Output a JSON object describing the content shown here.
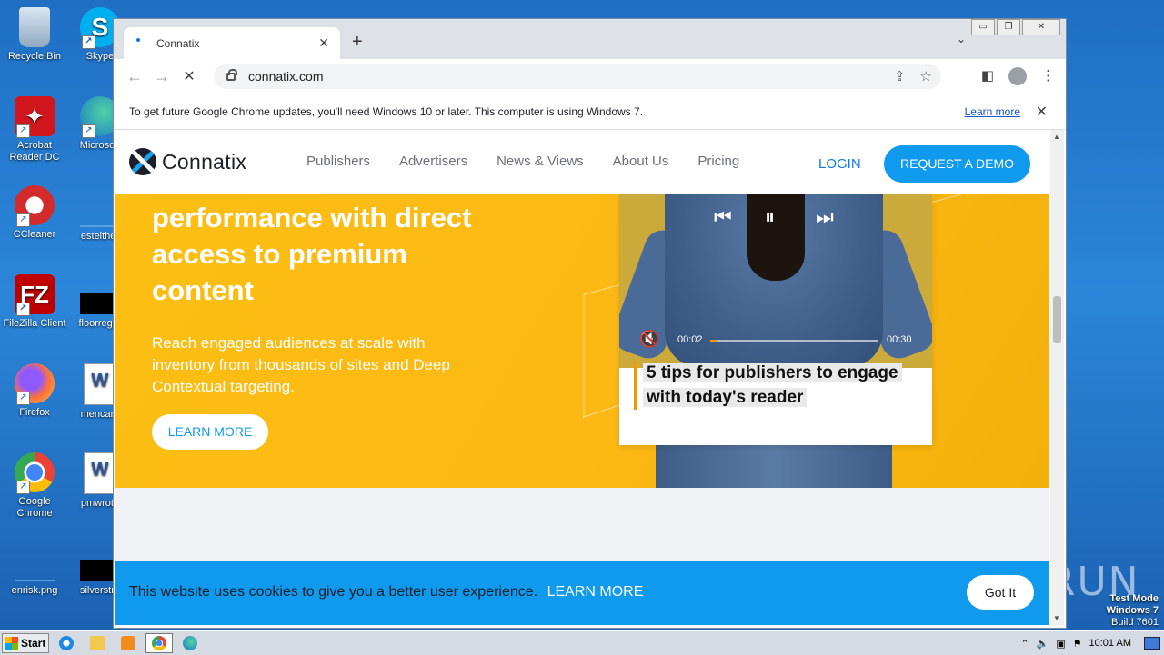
{
  "desktop": {
    "icons": [
      {
        "label": "Recycle Bin"
      },
      {
        "label": "Skype"
      },
      {
        "label": "Acrobat Reader DC"
      },
      {
        "label": "Microsoft"
      },
      {
        "label": "CCleaner"
      },
      {
        "label": "esteither"
      },
      {
        "label": "FileZilla Client"
      },
      {
        "label": "floorregar"
      },
      {
        "label": "Firefox"
      },
      {
        "label": "mencare"
      },
      {
        "label": "Google Chrome"
      },
      {
        "label": "pmwrote"
      },
      {
        "label": "enrisk.png"
      },
      {
        "label": "silverstru"
      }
    ],
    "watermark": {
      "line1": "Test Mode",
      "line2": "Windows 7",
      "line3": "Build 7601"
    },
    "brand_watermark": "ANY RUN"
  },
  "taskbar": {
    "start_label": "Start",
    "clock": "10:01 AM"
  },
  "browser": {
    "tab_title": "Connatix",
    "new_tab_label": "+",
    "address": "connatix.com",
    "infobar": {
      "message": "To get future Google Chrome updates, you'll need Windows 10 or later. This computer is using Windows 7.",
      "link": "Learn more"
    }
  },
  "site": {
    "logo_text": "Connatix",
    "nav": [
      "Publishers",
      "Advertisers",
      "News & Views",
      "About Us",
      "Pricing"
    ],
    "login": "LOGIN",
    "demo": "REQUEST A DEMO",
    "hero": {
      "title": "performance with direct access to premium content",
      "subtitle": "Reach engaged audiences at scale with inventory from thousands of sites and Deep Contextual targeting.",
      "cta": "LEARN MORE"
    },
    "player": {
      "time_current": "00:02",
      "time_duration": "00:30",
      "progress": 0.04,
      "caption": "5 tips for publishers to engage with today's reader"
    },
    "cookie": {
      "message": "This website uses cookies to give you a better user experience.",
      "link": "LEARN MORE",
      "button": "Got It"
    }
  },
  "colors": {
    "brand_blue": "#0f9aee",
    "hero_yellow": "#fcbf12",
    "accent_orange": "#f39a00"
  }
}
